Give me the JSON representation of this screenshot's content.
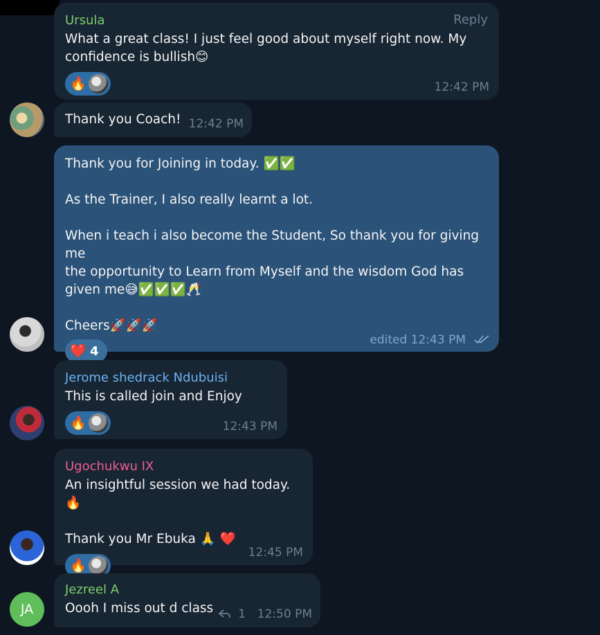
{
  "chat": {
    "m1": {
      "sender": "Ursula",
      "sender_color": "#7bcf6b",
      "reply_label": "Reply",
      "lines": [
        "What a great class! I just feel good about myself right now. My",
        "confidence is bullish😊"
      ],
      "reaction_emoji": "🔥",
      "time": "12:42 PM"
    },
    "m2": {
      "text": "Thank you Coach!",
      "time": "12:42 PM"
    },
    "m3": {
      "lines": [
        "Thank you for Joining in today. ✅✅",
        "",
        "As the Trainer, I also really learnt a lot.",
        "",
        "When i teach i also become the Student, So thank you for giving me",
        "the opportunity to Learn from Myself and the wisdom God has",
        "given me😅✅✅✅🥂",
        "",
        "Cheers🚀🚀🚀"
      ],
      "reaction_emoji": "❤️",
      "reaction_count": "4",
      "time": "edited 12:43 PM"
    },
    "m4": {
      "sender": "Jerome shedrack Ndubuisi",
      "sender_color": "#6ab3f3",
      "text": "This is called join and Enjoy",
      "reaction_emoji": "🔥",
      "time": "12:43 PM"
    },
    "m5": {
      "sender": "Ugochukwu IX",
      "sender_color": "#ee5f93",
      "lines": [
        "An insightful session we had today.🔥",
        "",
        "Thank you Mr Ebuka 🙏 ❤️"
      ],
      "reaction_emoji": "🔥",
      "time": "12:45 PM"
    },
    "m6": {
      "sender": "Jezreel A",
      "sender_color": "#7bcf6b",
      "text": "Oooh I miss out d class",
      "reply_count": "1",
      "time": "12:50 PM",
      "avatar_initials": "JA"
    }
  },
  "colors": {
    "background": "#0e1621",
    "bubble_incoming": "#182533",
    "bubble_outgoing": "#2b5278",
    "reaction_pill": "#2f6ea5"
  },
  "icons": [
    "fire-emoji",
    "heart-emoji",
    "double-check-icon",
    "reply-arrow-icon"
  ]
}
